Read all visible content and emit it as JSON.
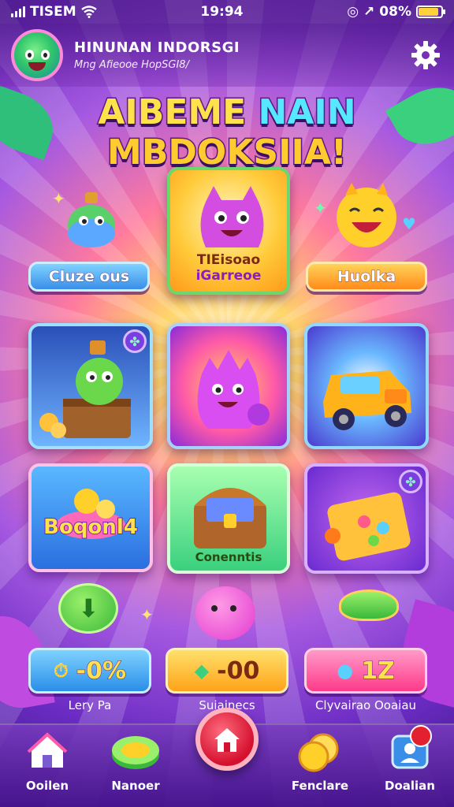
{
  "status": {
    "carrier": "TISEM",
    "time": "19:94",
    "battery": "08%",
    "battery_level": 0.08
  },
  "header": {
    "title": "HINUNAN INDORSGI",
    "subtitle": "Mng Afieooe HopSGI8/"
  },
  "banner": {
    "line1_part1": "AIBEME",
    "line1_part2": "NAIN",
    "line2": "MBDOKSIIA!"
  },
  "top_tiles": [
    {
      "label": "Cluze ous",
      "color": "#4fb4ff"
    },
    {
      "label_line1": "TIEisoao",
      "label_line2": "iGarreoe",
      "color": "#ffb21a"
    },
    {
      "label": "Huolka",
      "color": "#ffa31a"
    }
  ],
  "grid_row1": [
    {
      "name": "treasure-chest-creature",
      "color": "#3a6fd8"
    },
    {
      "name": "pink-blob-creature",
      "color": "#c22fd8"
    },
    {
      "name": "golden-car",
      "color": "#4a5ee0"
    }
  ],
  "grid_row2": [
    {
      "label": "Boqonl4",
      "color": "#3aa8ff"
    },
    {
      "label": "Conenntis",
      "color": "#55e07a"
    },
    {
      "name": "golden-chest",
      "color": "#8a3ae0"
    }
  ],
  "stats": [
    {
      "value": "-0%",
      "caption": "Lery Pa",
      "color": "#3ab0ff"
    },
    {
      "value": "-00",
      "caption": "Suiainecs",
      "color": "#ffc21a"
    },
    {
      "value": "1Z",
      "caption": "Clyvairao Ooaiau",
      "color": "#ff5aa8"
    }
  ],
  "nav": [
    {
      "label": "Ooilen",
      "icon": "home-icon"
    },
    {
      "label": "Nanoer",
      "icon": "disc-icon"
    },
    {
      "label": "",
      "icon": "home-center-icon"
    },
    {
      "label": "Fenclare",
      "icon": "coin-icon"
    },
    {
      "label": "Doalian",
      "icon": "profile-icon"
    }
  ]
}
